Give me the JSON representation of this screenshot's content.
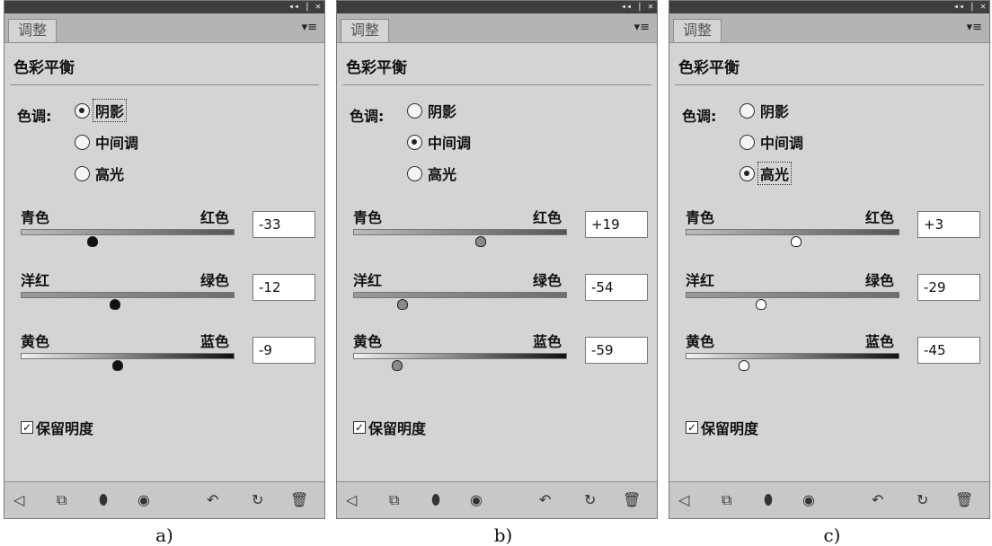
{
  "panels": [
    {
      "caption": "a)",
      "window_controls": "◂◂ | ✕",
      "tab": "调整",
      "menu_icon": "▾≡",
      "title": "色彩平衡",
      "tone_label": "色调:",
      "tones": [
        {
          "label": "阴影",
          "selected": true
        },
        {
          "label": "中间调",
          "selected": false
        },
        {
          "label": "高光",
          "selected": false
        }
      ],
      "sliders": [
        {
          "left": "青色",
          "right": "红色",
          "value": "-33",
          "level": -33
        },
        {
          "left": "洋红",
          "right": "绿色",
          "value": "-12",
          "level": -12
        },
        {
          "left": "黄色",
          "right": "蓝色",
          "value": "-9",
          "level": -9
        }
      ],
      "preserve_luminosity": {
        "label": "保留明度",
        "checked": true
      },
      "thumb_style": "black",
      "bottom_icons": [
        "back-arrow-icon",
        "clip-layer-icon",
        "visibility-icon",
        "eye-icon",
        "previous-state-icon",
        "reset-icon",
        "trash-icon"
      ]
    },
    {
      "caption": "b)",
      "window_controls": "◂◂ | ✕",
      "tab": "调整",
      "menu_icon": "▾≡",
      "title": "色彩平衡",
      "tone_label": "色调:",
      "tones": [
        {
          "label": "阴影",
          "selected": false
        },
        {
          "label": "中间调",
          "selected": true
        },
        {
          "label": "高光",
          "selected": false
        }
      ],
      "sliders": [
        {
          "left": "青色",
          "right": "红色",
          "value": "+19",
          "level": 19
        },
        {
          "left": "洋红",
          "right": "绿色",
          "value": "-54",
          "level": -54
        },
        {
          "left": "黄色",
          "right": "蓝色",
          "value": "-59",
          "level": -59
        }
      ],
      "preserve_luminosity": {
        "label": "保留明度",
        "checked": true
      },
      "thumb_style": "gray",
      "bottom_icons": [
        "back-arrow-icon",
        "clip-layer-icon",
        "visibility-icon",
        "eye-icon",
        "previous-state-icon",
        "reset-icon",
        "trash-icon"
      ]
    },
    {
      "caption": "c)",
      "window_controls": "◂◂ | ✕",
      "tab": "调整",
      "menu_icon": "▾≡",
      "title": "色彩平衡",
      "tone_label": "色调:",
      "tones": [
        {
          "label": "阴影",
          "selected": false
        },
        {
          "label": "中间调",
          "selected": false
        },
        {
          "label": "高光",
          "selected": true
        }
      ],
      "sliders": [
        {
          "left": "青色",
          "right": "红色",
          "value": "+3",
          "level": 3
        },
        {
          "left": "洋红",
          "right": "绿色",
          "value": "-29",
          "level": -29
        },
        {
          "left": "黄色",
          "right": "蓝色",
          "value": "-45",
          "level": -45
        }
      ],
      "preserve_luminosity": {
        "label": "保留明度",
        "checked": true
      },
      "thumb_style": "white",
      "bottom_icons": [
        "back-arrow-icon",
        "clip-layer-icon",
        "visibility-icon",
        "eye-icon",
        "previous-state-icon",
        "reset-icon",
        "trash-icon"
      ]
    }
  ]
}
